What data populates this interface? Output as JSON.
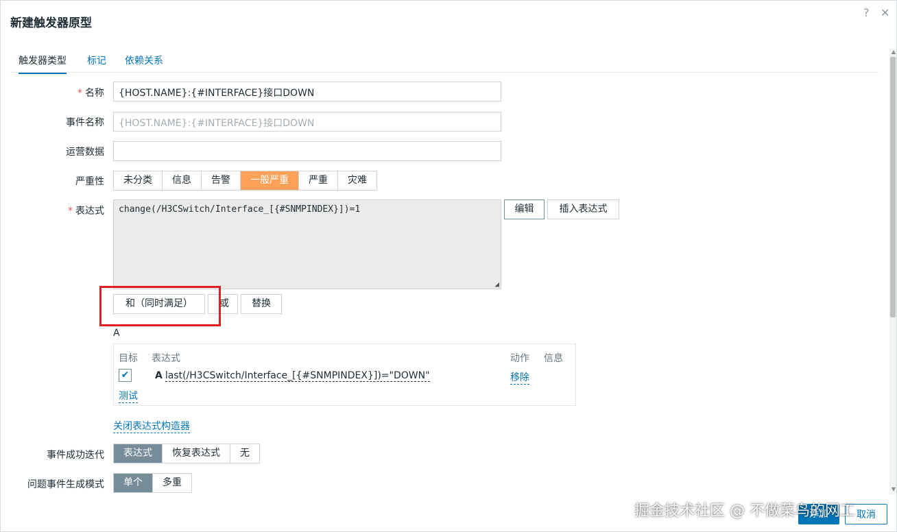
{
  "dialog": {
    "title": "新建触发器原型",
    "help_icon": "?",
    "close_icon": "✕"
  },
  "tabs": [
    {
      "label": "触发器类型",
      "active": true
    },
    {
      "label": "标记",
      "active": false
    },
    {
      "label": "依赖关系",
      "active": false
    }
  ],
  "form": {
    "name": {
      "label": "名称",
      "required": "*",
      "value": "{HOST.NAME}:{#INTERFACE}接口DOWN"
    },
    "event_name": {
      "label": "事件名称",
      "placeholder": "{HOST.NAME}:{#INTERFACE}接口DOWN"
    },
    "opdata": {
      "label": "运营数据",
      "value": ""
    },
    "severity": {
      "label": "严重性",
      "options": [
        "未分类",
        "信息",
        "告警",
        "一般严重",
        "严重",
        "灾难"
      ],
      "selected": "一般严重"
    },
    "expression": {
      "label": "表达式",
      "required": "*",
      "value": "change(/H3CSwitch/Interface_[{#SNMPINDEX}])=1",
      "edit_button": "编辑",
      "insert_button": "插入表达式"
    },
    "expr_ops": {
      "and": "和（同时满足）",
      "or": "或",
      "replace": "替换"
    },
    "builder": {
      "group_label": "A",
      "headers": {
        "target": "目标",
        "expression": "表达式",
        "action": "动作",
        "info": "信息"
      },
      "row": {
        "letter": "A",
        "expression": "last(/H3CSwitch/Interface_[{#SNMPINDEX}])=\"DOWN\"",
        "action": "移除",
        "checked": true
      },
      "test_link": "测试"
    },
    "close_builder_link": "关闭表达式构造器",
    "ok_event_gen": {
      "label": "事件成功迭代",
      "options": [
        "表达式",
        "恢复表达式",
        "无"
      ],
      "selected": "表达式"
    },
    "problem_mode": {
      "label": "问题事件生成模式",
      "options": [
        "单个",
        "多重"
      ],
      "selected": "单个"
    }
  },
  "footer": {
    "add_button": "添加",
    "cancel_button": "取消"
  },
  "watermark": "掘金技术社区 @ 不做菜鸟的网工",
  "colors": {
    "link": "#0275b8",
    "severity_average": "#ffa059",
    "selected_segment": "#768d99",
    "highlight_box": "#e32020"
  }
}
